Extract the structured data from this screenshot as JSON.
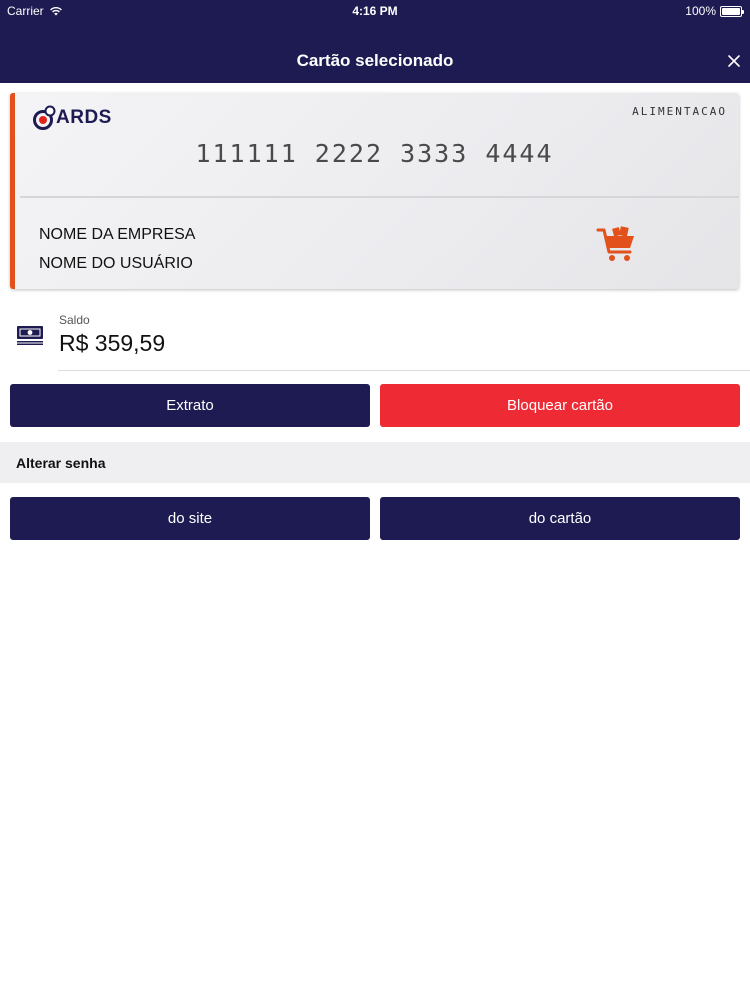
{
  "status_bar": {
    "carrier": "Carrier",
    "time": "4:16 PM",
    "battery": "100%",
    "icons": [
      "wifi-icon",
      "battery-icon"
    ]
  },
  "header": {
    "title": "Cartão selecionado",
    "close_icon": "close-icon"
  },
  "card": {
    "logo_text": "ARDS",
    "type": "ALIMENTACAO",
    "number": "111111 2222 3333 4444",
    "company": "NOME DA EMPRESA",
    "user": "NOME DO USUÁRIO",
    "category_icon": "shopping-cart-icon",
    "accent_color": "#e2501c"
  },
  "balance": {
    "label": "Saldo",
    "value": "R$ 359,59",
    "icon": "money-icon"
  },
  "actions": {
    "statement_label": "Extrato",
    "block_label": "Bloquear cartão"
  },
  "password_section": {
    "title": "Alterar senha",
    "site_label": "do site",
    "card_label": "do cartão"
  },
  "colors": {
    "navy": "#1d1b52",
    "red": "#ee2b35",
    "section_bg": "#efeff1"
  }
}
